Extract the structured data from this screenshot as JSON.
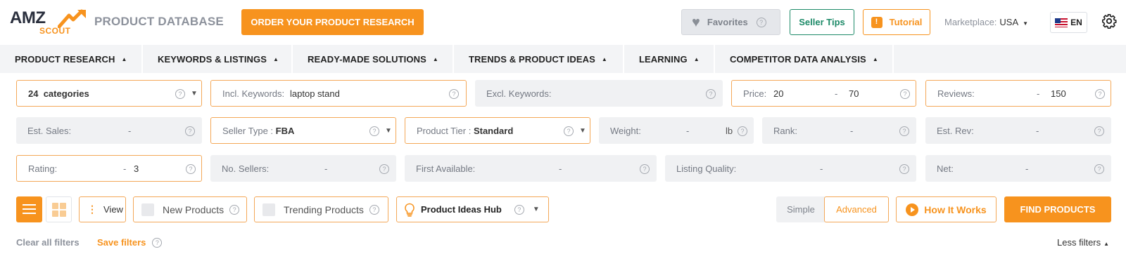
{
  "header": {
    "logo_amz": "AMZ",
    "logo_scout": "SCOUT",
    "app_title": "PRODUCT DATABASE",
    "order_button": "ORDER YOUR PRODUCT RESEARCH",
    "favorites_button": "Favorites",
    "seller_tips_button": "Seller Tips",
    "tutorial_button": "Tutorial",
    "marketplace_label": "Marketplace:",
    "marketplace_value": "USA",
    "language": "EN"
  },
  "nav": {
    "items": [
      {
        "label": "PRODUCT RESEARCH"
      },
      {
        "label": "KEYWORDS & LISTINGS"
      },
      {
        "label": "READY-MADE SOLUTIONS"
      },
      {
        "label": "TRENDS & PRODUCT IDEAS"
      },
      {
        "label": "LEARNING"
      },
      {
        "label": "COMPETITOR DATA ANALYSIS"
      }
    ]
  },
  "filters": {
    "categories": {
      "count": "24",
      "label": "categories"
    },
    "incl_keywords": {
      "label": "Incl. Keywords:",
      "value": "laptop stand"
    },
    "excl_keywords": {
      "label": "Excl. Keywords:",
      "value": ""
    },
    "price": {
      "label": "Price:",
      "min": "20",
      "max": "70"
    },
    "reviews": {
      "label": "Reviews:",
      "min": "",
      "max": "150"
    },
    "est_sales": {
      "label": "Est. Sales:"
    },
    "seller_type": {
      "label": "Seller Type :",
      "value": "FBA"
    },
    "product_tier": {
      "label": "Product Tier :",
      "value": "Standard"
    },
    "weight": {
      "label": "Weight:",
      "unit": "lb"
    },
    "rank": {
      "label": "Rank:"
    },
    "est_rev": {
      "label": "Est. Rev:"
    },
    "rating": {
      "label": "Rating:",
      "min": "",
      "max": "3"
    },
    "no_sellers": {
      "label": "No. Sellers:"
    },
    "first_available": {
      "label": "First Available:"
    },
    "listing_quality": {
      "label": "Listing Quality:"
    },
    "net": {
      "label": "Net:"
    },
    "range_dash": "-",
    "help_glyph": "?"
  },
  "toolbar": {
    "view_label": "View",
    "new_products": "New Products",
    "trending_products": "Trending Products",
    "product_ideas_hub": "Product Ideas Hub",
    "mode_simple": "Simple",
    "mode_advanced": "Advanced",
    "how_it_works": "How It Works",
    "find_products": "FIND PRODUCTS"
  },
  "footer": {
    "clear_all": "Clear all filters",
    "save_filters": "Save filters",
    "less_filters": "Less filters"
  },
  "colors": {
    "accent": "#f7931e",
    "seller_tips": "#1d8a68",
    "field_bg": "#f0f1f3"
  }
}
